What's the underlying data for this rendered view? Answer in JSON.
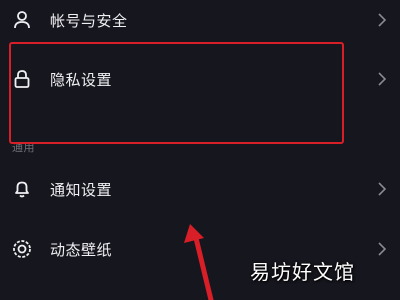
{
  "colors": {
    "background": "#16161e",
    "text": "#f0f0f4",
    "section_header": "#70707a",
    "chevron": "#8a8a92",
    "annotation_red": "#d81e26"
  },
  "menu": {
    "items": [
      {
        "label": "帐号与安全",
        "icon": "person-icon"
      },
      {
        "label": "隐私设置",
        "icon": "lock-icon"
      },
      {
        "label": "通知设置",
        "icon": "bell-icon"
      },
      {
        "label": "动态壁纸",
        "icon": "wallpaper-icon"
      }
    ],
    "section_general": "通用"
  },
  "watermark": {
    "text": "易坊好文馆"
  }
}
